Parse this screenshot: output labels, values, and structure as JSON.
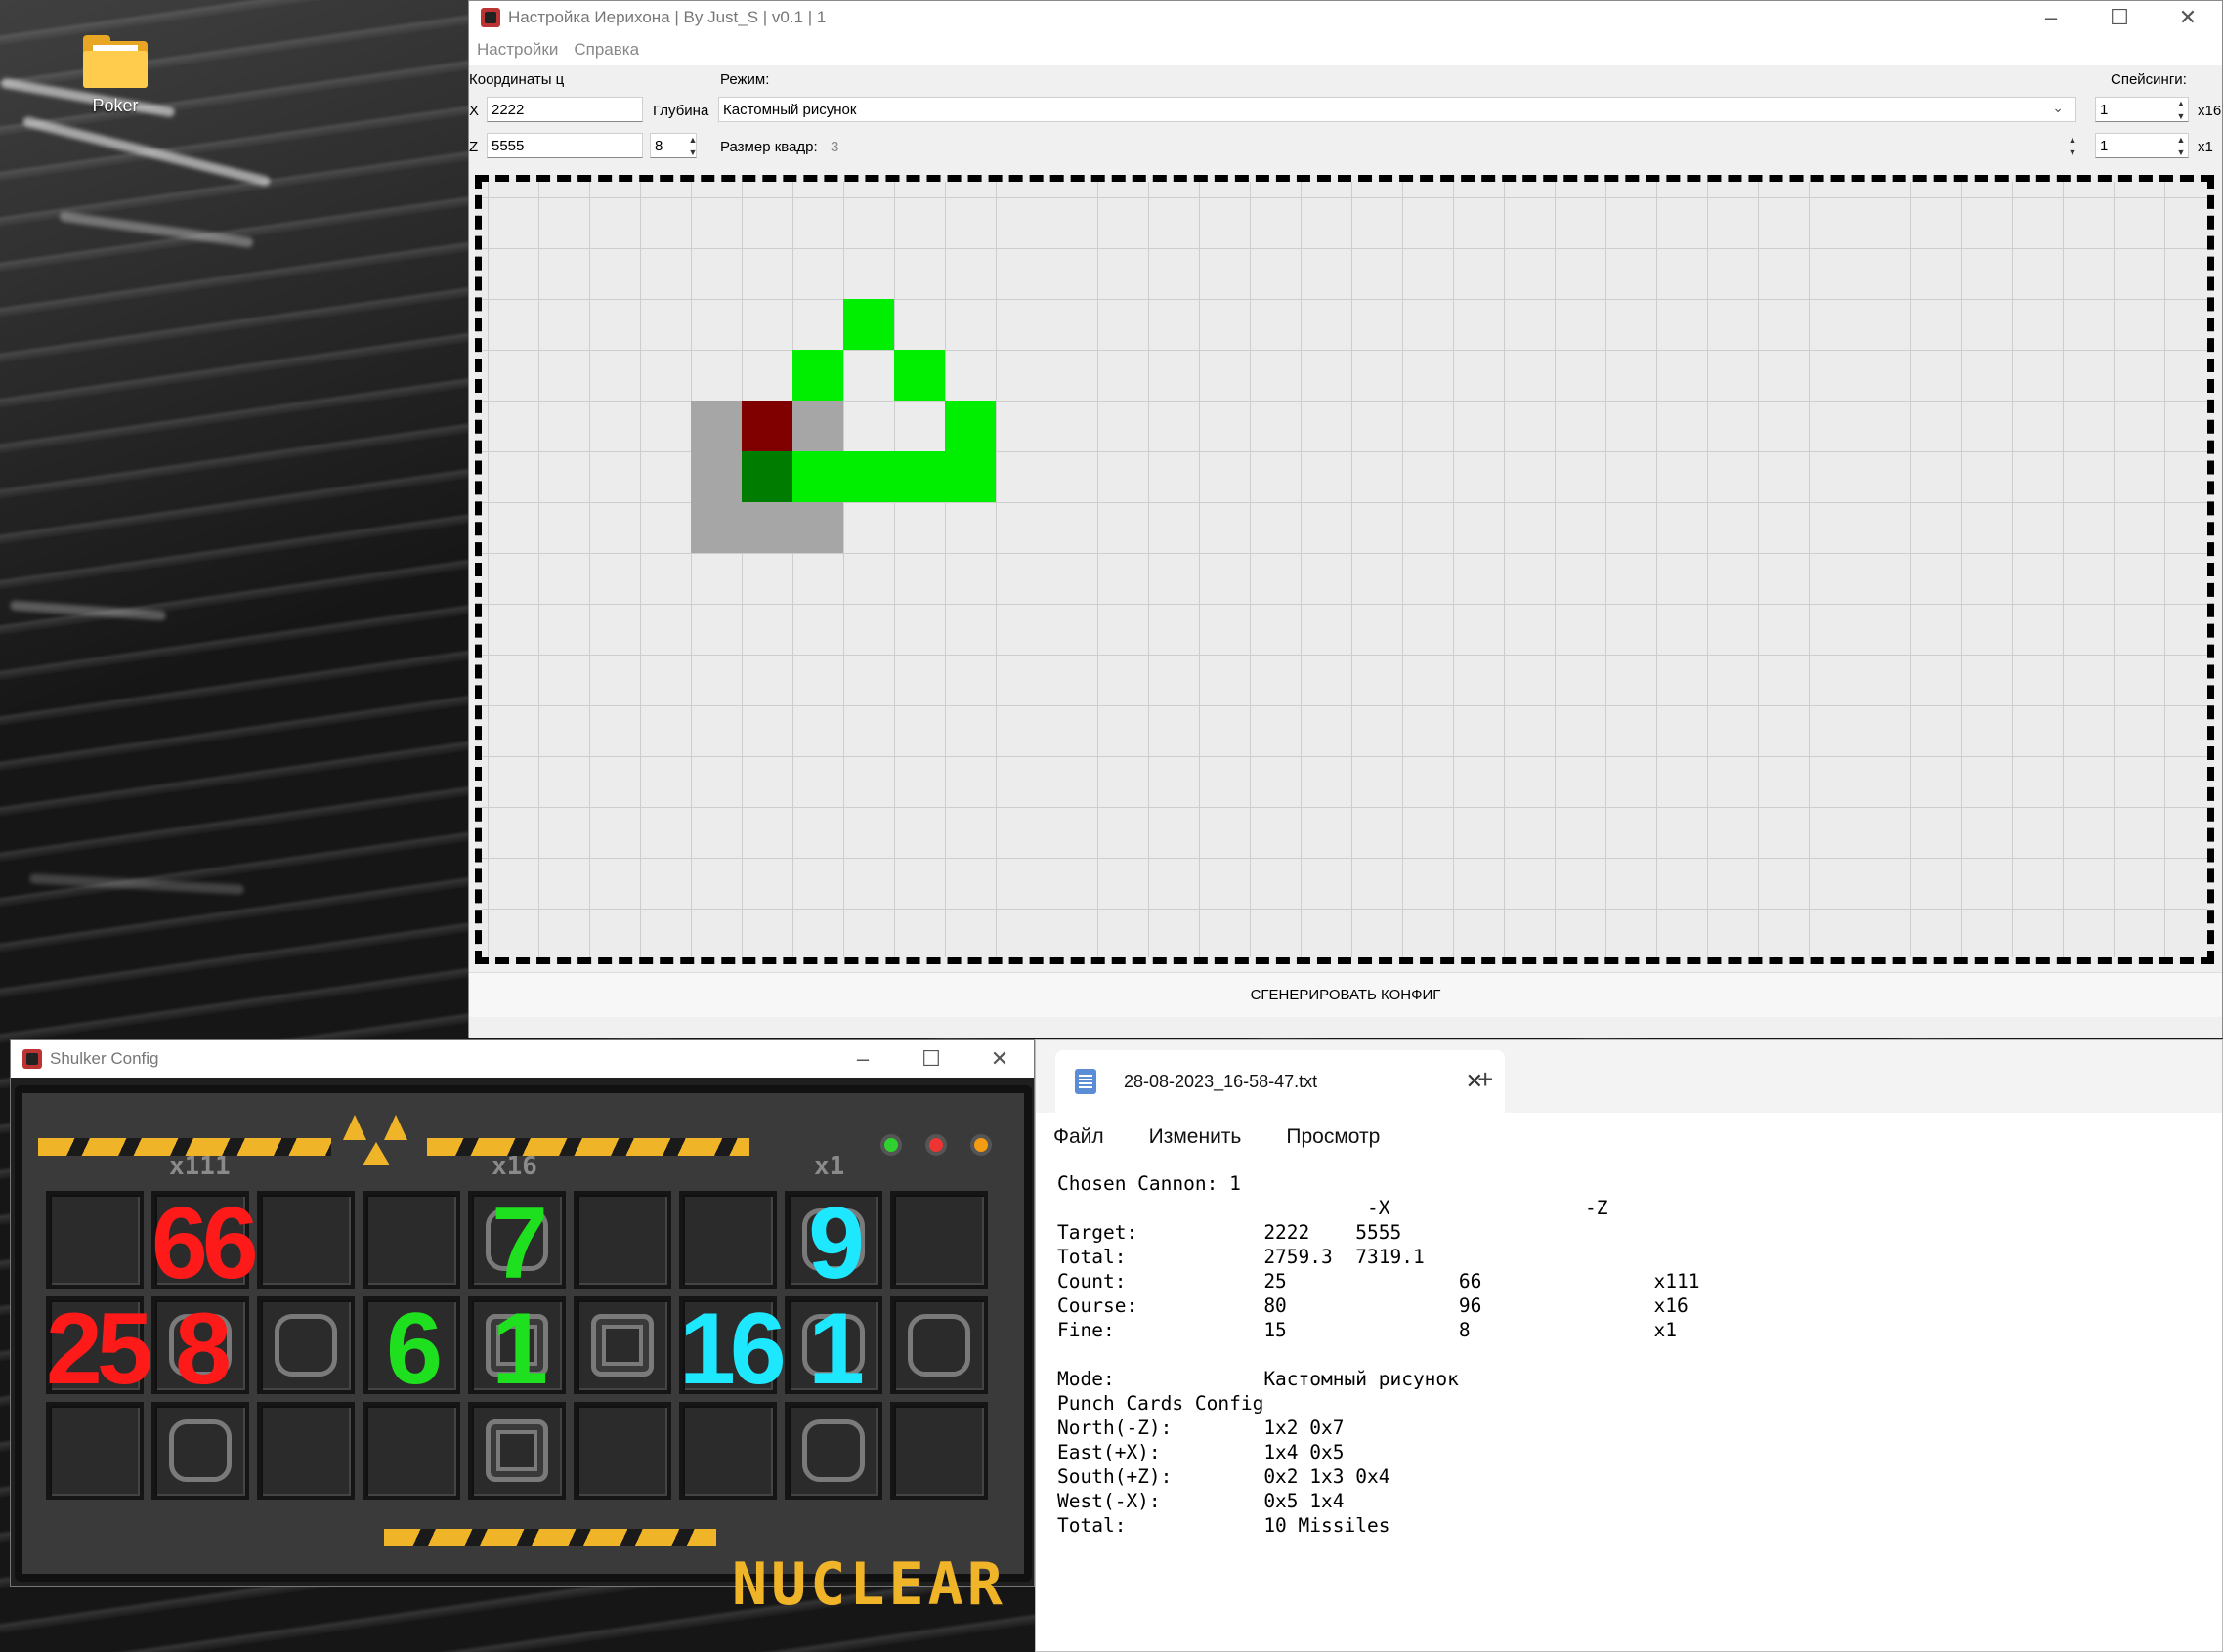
{
  "desktop": {
    "icon_label": "Poker"
  },
  "main_window": {
    "title": "Настройка Иерихона | By Just_S | v0.1 | 1",
    "menu": [
      "Настройки",
      "Справка"
    ],
    "coords_label": "Координаты ц",
    "x_label": "X",
    "z_label": "Z",
    "x_value": "2222",
    "z_value": "5555",
    "depth_label": "Глубина",
    "depth_value": "8",
    "mode_label": "Режим:",
    "mode_value": "Кастомный рисунок",
    "square_size_label": "Размер квадр:",
    "square_size_value": "3",
    "specs_label": "Спейсинги:",
    "spec1_value": "1",
    "spec2_value": "1",
    "spec1_suffix": "x16",
    "spec2_suffix": "x1",
    "generate_button": "СГЕНЕРИРОВАТЬ КОНФИГ",
    "grid_cells": [
      {
        "row": 2,
        "col": 6,
        "color": "#00ee00"
      },
      {
        "row": 3,
        "col": 5,
        "color": "#00ee00"
      },
      {
        "row": 3,
        "col": 7,
        "color": "#00ee00"
      },
      {
        "row": 4,
        "col": 3,
        "color": "#a6a6a6"
      },
      {
        "row": 4,
        "col": 4,
        "color": "#800000"
      },
      {
        "row": 4,
        "col": 5,
        "color": "#a6a6a6"
      },
      {
        "row": 4,
        "col": 8,
        "color": "#00ee00"
      },
      {
        "row": 5,
        "col": 3,
        "color": "#a6a6a6"
      },
      {
        "row": 5,
        "col": 4,
        "color": "#007d00"
      },
      {
        "row": 5,
        "col": 5,
        "color": "#00ee00"
      },
      {
        "row": 5,
        "col": 6,
        "color": "#00ee00"
      },
      {
        "row": 5,
        "col": 7,
        "color": "#00ee00"
      },
      {
        "row": 5,
        "col": 8,
        "color": "#00ee00"
      },
      {
        "row": 6,
        "col": 3,
        "color": "#a6a6a6"
      },
      {
        "row": 6,
        "col": 4,
        "color": "#a6a6a6"
      },
      {
        "row": 6,
        "col": 5,
        "color": "#a6a6a6"
      }
    ]
  },
  "shulker_window": {
    "title": "Shulker Config",
    "multipliers": [
      "x111",
      "x16",
      "x1"
    ],
    "slot_numbers": [
      {
        "row": 0,
        "col": 1,
        "text": "66",
        "color": "#ff1a1a"
      },
      {
        "row": 0,
        "col": 4,
        "text": "7",
        "color": "#1ee01e"
      },
      {
        "row": 0,
        "col": 7,
        "text": "9",
        "color": "#1ee8ff"
      },
      {
        "row": 1,
        "col": 0,
        "text": "25",
        "color": "#ff1a1a"
      },
      {
        "row": 1,
        "col": 1,
        "text": "8",
        "color": "#ff1a1a"
      },
      {
        "row": 1,
        "col": 3,
        "text": "6",
        "color": "#1ee01e"
      },
      {
        "row": 1,
        "col": 4,
        "text": "1",
        "color": "#1ee01e"
      },
      {
        "row": 1,
        "col": 6,
        "text": "16",
        "color": "#1ee8ff"
      },
      {
        "row": 1,
        "col": 7,
        "text": "1",
        "color": "#1ee8ff"
      }
    ],
    "nuclear_label": "NUCLEAR"
  },
  "notepad": {
    "tab_name": "28-08-2023_16-58-47.txt",
    "menu": [
      "Файл",
      "Изменить",
      "Просмотр"
    ],
    "lines": [
      "Chosen Cannon: 1",
      "                           -X                 -Z",
      "Target:           2222    5555",
      "Total:            2759.3  7319.1",
      "Count:            25               66               x111",
      "Course:           80               96               x16",
      "Fine:             15               8                x1",
      "",
      "Mode:             Кастомный рисунок",
      "Punch Cards Config",
      "North(-Z):        1x2 0x7",
      "East(+X):         1x4 0x5",
      "South(+Z):        0x2 1x3 0x4",
      "West(-X):         0x5 1x4",
      "Total:            10 Missiles"
    ]
  },
  "colors": {
    "hazard_yellow": "#f0b429",
    "bright_green": "#00ee00",
    "dark_red": "#800000",
    "dark_green": "#007d00",
    "grey": "#a6a6a6"
  }
}
